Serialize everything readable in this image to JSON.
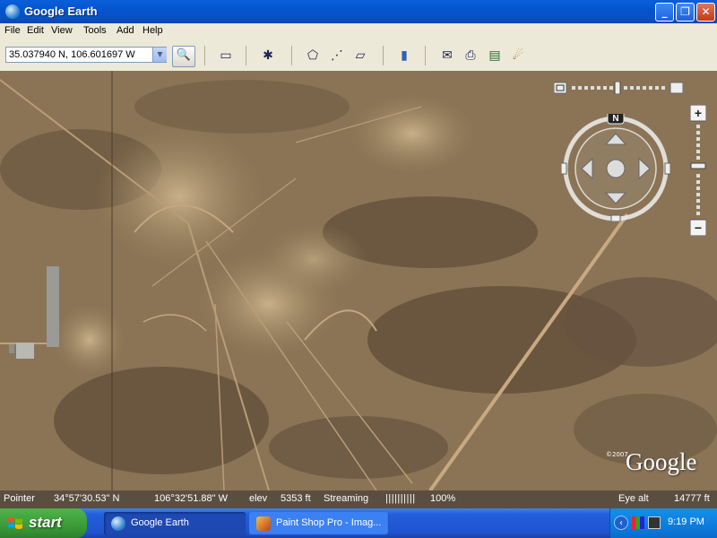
{
  "window": {
    "title": "Google Earth",
    "controls": {
      "minimize": "_",
      "maximize": "❐",
      "close": "✕"
    }
  },
  "menu": [
    "File",
    "Edit",
    "View",
    "Tools",
    "Add",
    "Help"
  ],
  "toolbar": {
    "coordinate_input": "35.037940 N, 106.601697 W",
    "buttons": [
      {
        "name": "sidebar-toggle-icon",
        "glyph": "▭"
      },
      {
        "name": "placemark-icon",
        "glyph": "✱"
      },
      {
        "name": "polygon-icon",
        "glyph": "⬠"
      },
      {
        "name": "path-icon",
        "glyph": "⋰"
      },
      {
        "name": "image-overlay-icon",
        "glyph": "▱"
      },
      {
        "name": "ruler-icon",
        "glyph": "▮"
      },
      {
        "name": "email-icon",
        "glyph": "✉"
      },
      {
        "name": "print-icon",
        "glyph": "⎙"
      },
      {
        "name": "maps-icon",
        "glyph": "▤"
      },
      {
        "name": "sky-icon",
        "glyph": "☄"
      }
    ]
  },
  "navigation": {
    "north_label": "N",
    "zoom_in": "+",
    "zoom_out": "−"
  },
  "map": {
    "copyright": "©2007",
    "logo": "Google"
  },
  "status": {
    "pointer_label": "Pointer",
    "latitude": "34°57'30.53\" N",
    "longitude": "106°32'51.88\" W",
    "elev_label": "elev",
    "elevation": "5353 ft",
    "streaming_label": "Streaming",
    "streaming_bar": "||||||||||",
    "streaming_percent": "100%",
    "eye_alt_label": "Eye alt",
    "eye_alt_value": "14777 ft"
  },
  "taskbar": {
    "start_label": "start",
    "tasks": [
      {
        "label": "Google Earth",
        "active": true
      },
      {
        "label": "Paint Shop Pro - Imag...",
        "active": false
      }
    ],
    "clock": "9:19 PM"
  }
}
